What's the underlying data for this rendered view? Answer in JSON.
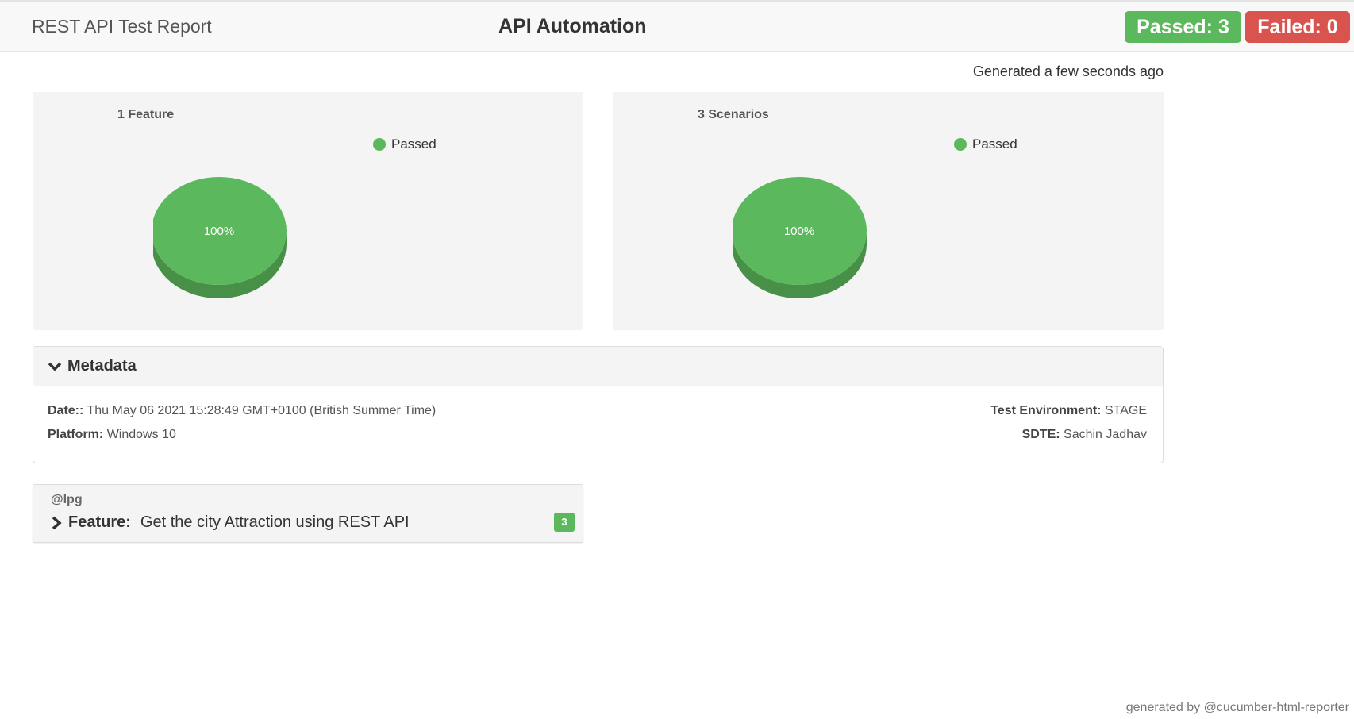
{
  "navbar": {
    "brand": "REST API Test Report",
    "title": "API Automation",
    "passed_label": "Passed: 3",
    "failed_label": "Failed: 0",
    "passed_color": "#5cb85c",
    "failed_color": "#d9534f"
  },
  "generated": "Generated a few seconds ago",
  "chart_data": [
    {
      "type": "pie",
      "title": "1 Feature",
      "labels": [
        "Passed"
      ],
      "values": [
        1
      ],
      "data_labels": [
        "100%"
      ],
      "colors": [
        "#5cb85c"
      ],
      "legend": "top-right"
    },
    {
      "type": "pie",
      "title": "3 Scenarios",
      "labels": [
        "Passed"
      ],
      "values": [
        3
      ],
      "data_labels": [
        "100%"
      ],
      "colors": [
        "#5cb85c"
      ],
      "legend": "top-right"
    }
  ],
  "metadata": {
    "heading": "Metadata",
    "date_label": "Date::",
    "date_value": "Thu May 06 2021 15:28:49 GMT+0100 (British Summer Time)",
    "platform_label": "Platform:",
    "platform_value": "Windows 10",
    "env_label": "Test Environment:",
    "env_value": "STAGE",
    "sdte_label": "SDTE:",
    "sdte_value": "Sachin Jadhav"
  },
  "features": [
    {
      "tag": "@lpg",
      "keyword": "Feature:",
      "name": "Get the city Attraction using REST API",
      "count": "3"
    }
  ],
  "icons": {
    "metadata_toggle": "chevron-down-icon",
    "feature_toggle": "chevron-right-icon"
  },
  "footer": "generated by @cucumber-html-reporter"
}
